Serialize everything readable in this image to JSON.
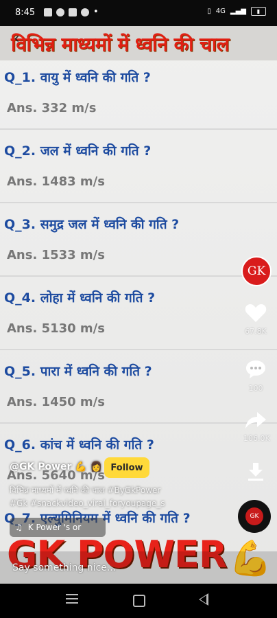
{
  "status": {
    "time": "8:45",
    "right_label": "4G"
  },
  "video": {
    "title": "विभिन्न माध्यमों में ध्वनि की चाल",
    "items": [
      {
        "q": "Q_1. वायु  में ध्वनि की गति  ?",
        "a": "Ans.  332 m/s"
      },
      {
        "q": "Q_2. जल  में ध्वनि की गति  ?",
        "a": "Ans.  1483 m/s"
      },
      {
        "q": "Q_3. समुद्र जल  में ध्वनि की गति  ?",
        "a": "Ans.  1533 m/s"
      },
      {
        "q": "Q_4. लोहा  में ध्वनि की गति  ?",
        "a": "Ans.  5130 m/s"
      },
      {
        "q": "Q_5. पारा  में ध्वनि की गति  ?",
        "a": "Ans.  1450 m/s"
      },
      {
        "q": "Q_6. कांच  में ध्वनि की गति  ?",
        "a": "Ans.  5640 m/s"
      },
      {
        "q": "Q_7. एल्युमिनियम  में ध्वनि की गति  ?",
        "a": ""
      }
    ],
    "brand": "GK POWER"
  },
  "side": {
    "avatar": "GK",
    "likes": "67.8K",
    "comments": "100",
    "shares": "106.0K"
  },
  "post": {
    "username": "@GK Power",
    "follow_label": "Follow",
    "caption": "विभिन्न माध्यमों में ध्वनि की चाल #ByGkPower",
    "hashtags": "#Gk #snackvideo_viral_foryoupage_s",
    "music": "K Power 's or"
  },
  "comment_placeholder": "Say something nice..."
}
